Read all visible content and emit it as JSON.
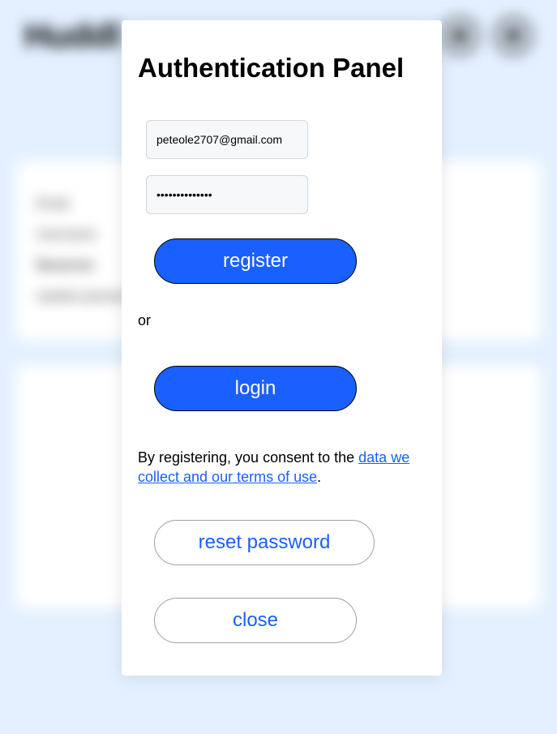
{
  "background": {
    "logo": "Huddl",
    "card1": {
      "row1": "Email",
      "row2": "Username",
      "row3": "Reserves",
      "row4": "Update password"
    }
  },
  "modal": {
    "title": "Authentication Panel",
    "email_value": "peteole2707@gmail.com",
    "password_value": "••••••••••••••",
    "register_label": "register",
    "or_text": "or",
    "login_label": "login",
    "consent_prefix": "By registering, you consent to the ",
    "consent_link": "data we collect and our terms of use",
    "consent_suffix": ".",
    "reset_label": "reset password",
    "close_label": "close"
  }
}
